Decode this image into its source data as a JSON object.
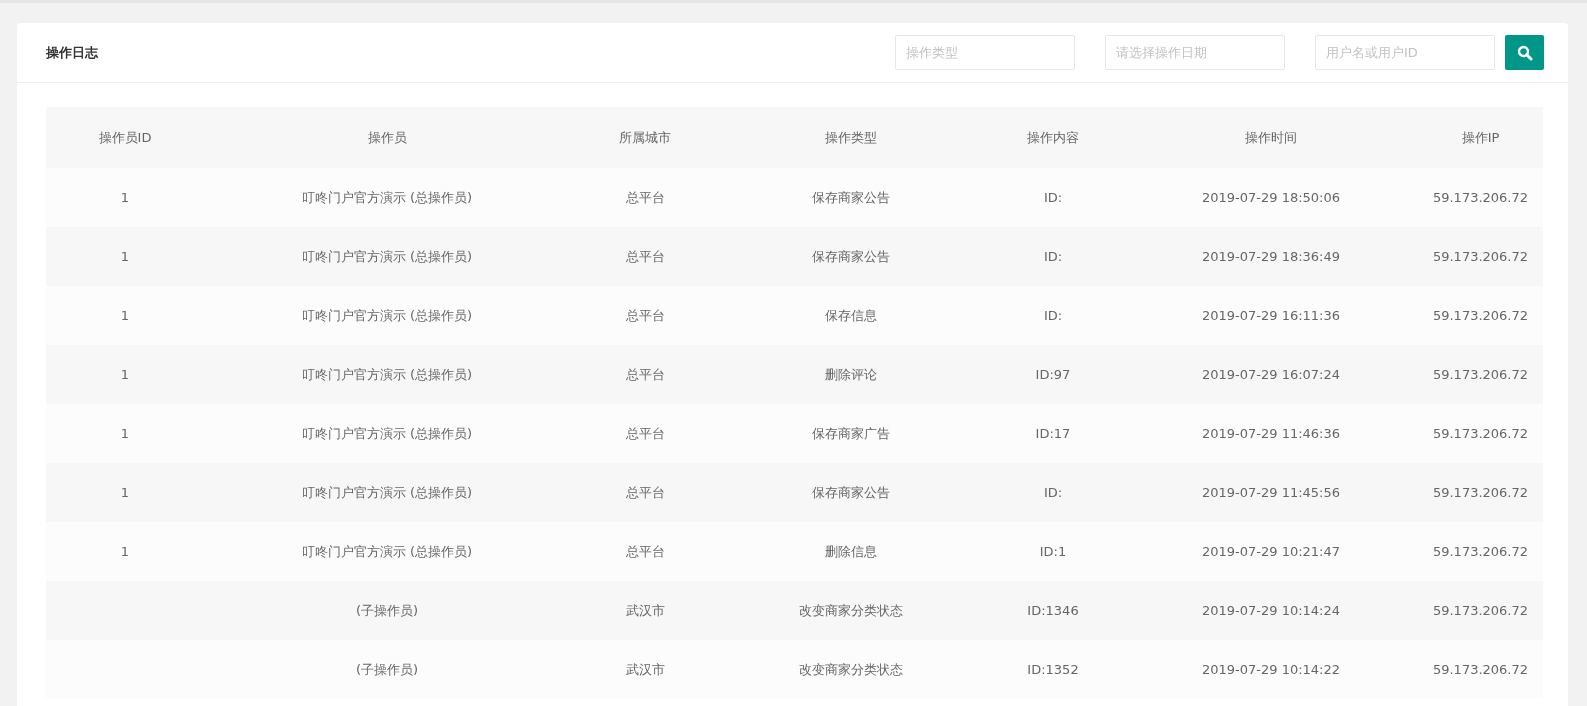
{
  "panel": {
    "title": "操作日志"
  },
  "filters": [
    {
      "placeholder": "操作类型"
    },
    {
      "placeholder": "请选择操作日期"
    },
    {
      "placeholder": "用户名或用户ID"
    }
  ],
  "table": {
    "columns": [
      "操作员ID",
      "操作员",
      "所属城市",
      "操作类型",
      "操作内容",
      "操作时间",
      "操作IP"
    ],
    "rows": [
      {
        "operator_id": "1",
        "operator": "叮咚门户官方演示 (总操作员)",
        "city": "总平台",
        "type": "保存商家公告",
        "content": "ID:",
        "time": "2019-07-29 18:50:06",
        "ip": "59.173.206.72"
      },
      {
        "operator_id": "1",
        "operator": "叮咚门户官方演示 (总操作员)",
        "city": "总平台",
        "type": "保存商家公告",
        "content": "ID:",
        "time": "2019-07-29 18:36:49",
        "ip": "59.173.206.72"
      },
      {
        "operator_id": "1",
        "operator": "叮咚门户官方演示 (总操作员)",
        "city": "总平台",
        "type": "保存信息",
        "content": "ID:",
        "time": "2019-07-29 16:11:36",
        "ip": "59.173.206.72"
      },
      {
        "operator_id": "1",
        "operator": "叮咚门户官方演示 (总操作员)",
        "city": "总平台",
        "type": "删除评论",
        "content": "ID:97",
        "time": "2019-07-29 16:07:24",
        "ip": "59.173.206.72"
      },
      {
        "operator_id": "1",
        "operator": "叮咚门户官方演示 (总操作员)",
        "city": "总平台",
        "type": "保存商家广告",
        "content": "ID:17",
        "time": "2019-07-29 11:46:36",
        "ip": "59.173.206.72"
      },
      {
        "operator_id": "1",
        "operator": "叮咚门户官方演示 (总操作员)",
        "city": "总平台",
        "type": "保存商家公告",
        "content": "ID:",
        "time": "2019-07-29 11:45:56",
        "ip": "59.173.206.72"
      },
      {
        "operator_id": "1",
        "operator": "叮咚门户官方演示 (总操作员)",
        "city": "总平台",
        "type": "删除信息",
        "content": "ID:1",
        "time": "2019-07-29 10:21:47",
        "ip": "59.173.206.72"
      },
      {
        "operator": "(子操作员)",
        "city": "武汉市",
        "type": "改变商家分类状态",
        "content": "ID:1346",
        "time": "2019-07-29 10:14:24",
        "ip": "59.173.206.72"
      },
      {
        "operator": "(子操作员)",
        "city": "武汉市",
        "type": "改变商家分类状态",
        "content": "ID:1352",
        "time": "2019-07-29 10:14:22",
        "ip": "59.173.206.72"
      }
    ]
  }
}
